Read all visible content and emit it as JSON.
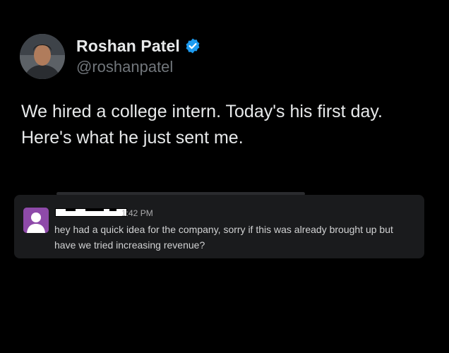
{
  "tweet": {
    "author": {
      "display_name": "Roshan Patel",
      "handle": "@roshanpatel",
      "verified": true,
      "verified_badge_color": "#1d9bf0"
    },
    "text_lines": [
      "We hired a college intern. Today's his first day.",
      "Here's what he just sent me."
    ]
  },
  "slack_message": {
    "timestamp": "1:42 PM",
    "avatar_color": "#8e4aa9",
    "message_lines": [
      "hey had a quick idea for the company, sorry if this was already brought up but",
      "have we tried increasing revenue?"
    ]
  }
}
